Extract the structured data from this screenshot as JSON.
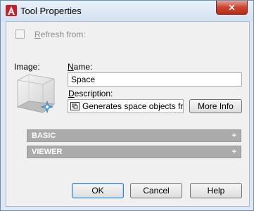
{
  "window": {
    "title": "Tool Properties",
    "close_label": "✕"
  },
  "refresh": {
    "label": "Refresh from:",
    "checked": false
  },
  "image": {
    "label": "Image:"
  },
  "name": {
    "label": "Name:",
    "value": "Space"
  },
  "description": {
    "label": "Description:",
    "value": "Generates space objects fro"
  },
  "more_info_button": "More Info",
  "sections": [
    {
      "label": "BASIC",
      "expander": "+"
    },
    {
      "label": "VIEWER",
      "expander": "+"
    }
  ],
  "buttons": {
    "ok": "OK",
    "cancel": "Cancel",
    "help": "Help"
  },
  "colors": {
    "app_icon": "#c8202a",
    "close_button": "#c9442f",
    "section_bar": "#ababab"
  }
}
